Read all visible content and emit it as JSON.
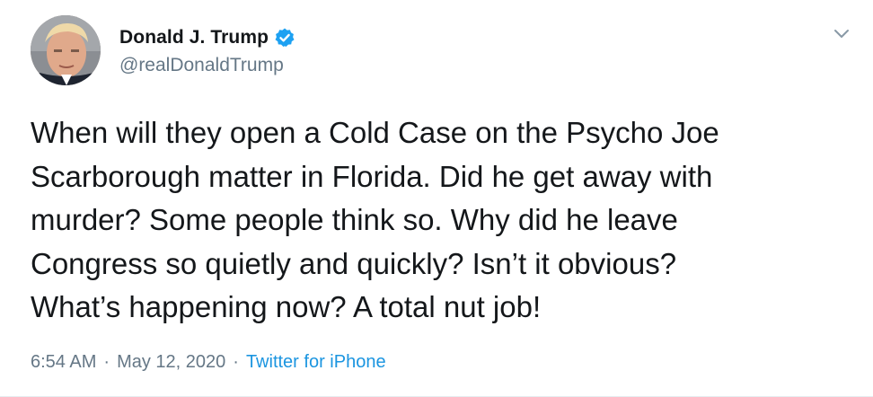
{
  "author": {
    "name": "Donald J. Trump",
    "handle": "@realDonaldTrump",
    "verified": true,
    "avatar_icon": "profile-photo"
  },
  "tweet": {
    "text": "When will they open a Cold Case on the Psycho Joe\nScarborough matter in Florida. Did he get away with\nmurder? Some people think so. Why did he leave\nCongress so quietly and quickly? Isn’t it obvious?\nWhat’s happening now? A total nut job!"
  },
  "meta": {
    "time": "6:54 AM",
    "separator": "·",
    "date": "May 12, 2020",
    "source": "Twitter for iPhone"
  },
  "colors": {
    "text": "#14171a",
    "secondary": "#657786",
    "accent": "#1b95e0",
    "verified_badge": "#1da1f2"
  },
  "icons": {
    "verified": "verified-badge-icon",
    "menu": "chevron-down-icon"
  }
}
